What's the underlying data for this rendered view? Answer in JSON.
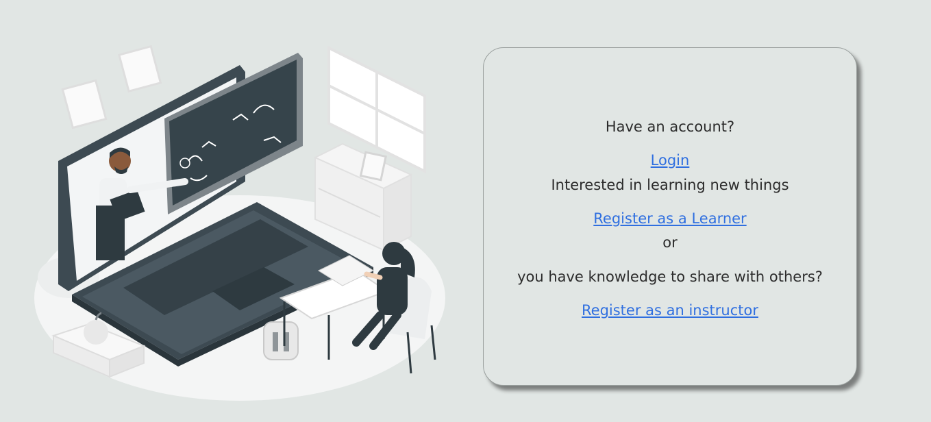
{
  "card": {
    "have_account": "Have an account?",
    "login": "Login",
    "interested": "Interested in learning new things",
    "register_learner": "Register as a Learner",
    "or": "or",
    "knowledge": "you have knowledge to share with others?",
    "register_instructor": "Register as an instructor"
  },
  "colors": {
    "background": "#e1e6e4",
    "link": "#2f6fe0",
    "text": "#2b2b2b",
    "laptop": "#3d4a52"
  }
}
